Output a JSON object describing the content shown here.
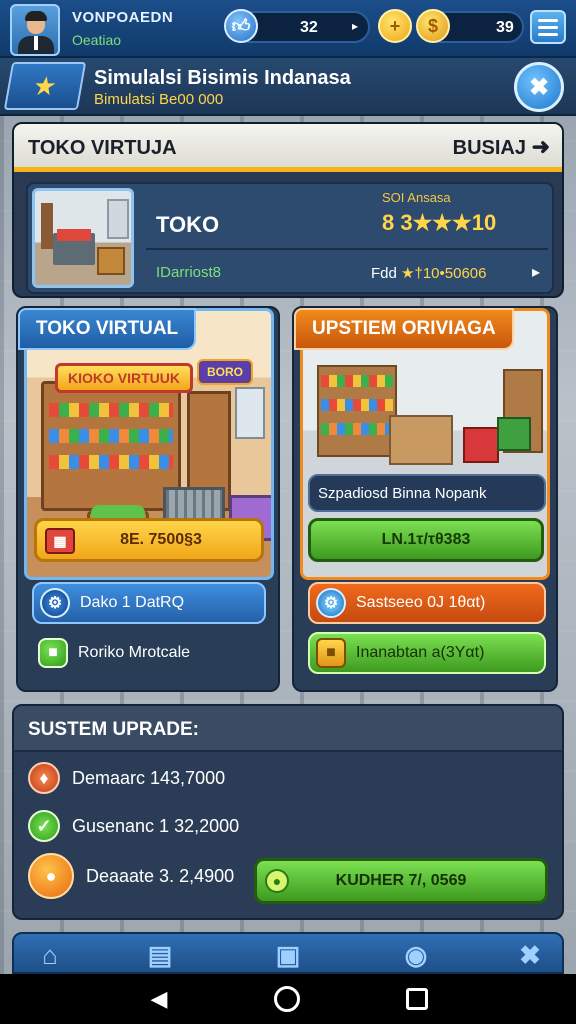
{
  "player": {
    "name": "VONPOAEDN",
    "subtitle": "Oeatiao"
  },
  "stats": [
    {
      "icon": "thumbs-up-icon",
      "value": "32"
    },
    {
      "icon": "gold-coin-icon",
      "value": "39"
    }
  ],
  "title": {
    "main": "Simulalsi Bisimis Indanasa",
    "sub": "Bimulatsi Be00 000"
  },
  "store": {
    "header_left": "TOKO VIRTUJA",
    "header_right": "BUSIAJ",
    "name": "TOKO",
    "score_label": "SOI Ansasa",
    "score": "8 3★★★★★★★★★★★★★★★★★★★★★★★★★★★★★★★★★★★★★★★★★★★★★★★★★★★★★★★★★★★★★★★★★★★★★★★★★★★★★★★★★★★★★★★★★★★★★★★★★★★★★★★★",
    "left_line": "IDarriost8",
    "right_line_label": "Fdd",
    "right_line_value": "★°10°50606"
  },
  "panel_left": {
    "tab": "TOKO VIRTUAL",
    "sign_text": "KIOKO VIRTUUK",
    "sign2_text": "BORO",
    "cta": "8E. 7500§3",
    "chip1": "Dako 1 DatRQ",
    "chip2": "Roriko Mrotcale"
  },
  "panel_right": {
    "tab": "UPSTIEM ORIVIAGA",
    "caption": "Szpadiosd Binna Nopank",
    "cta": "LN.1τ/τθ383",
    "chip1": "Sastseeo 0J 1θαt)",
    "chip2": "Inanabtan a(3Yαt)"
  },
  "upgrade": {
    "title": "SUSTEM UPRADE:",
    "rows": [
      {
        "label": "Demaarc 143,7000"
      },
      {
        "label": "Gusenanc 1 32,2000"
      },
      {
        "label": "Deaaate 3. 2,4900"
      }
    ],
    "button": "KUDHER 7/, 0569"
  },
  "colors": {
    "accent": "#f2b417",
    "green": "#5ec12e",
    "orange": "#f06a1c",
    "blue": "#2a7ccc"
  }
}
